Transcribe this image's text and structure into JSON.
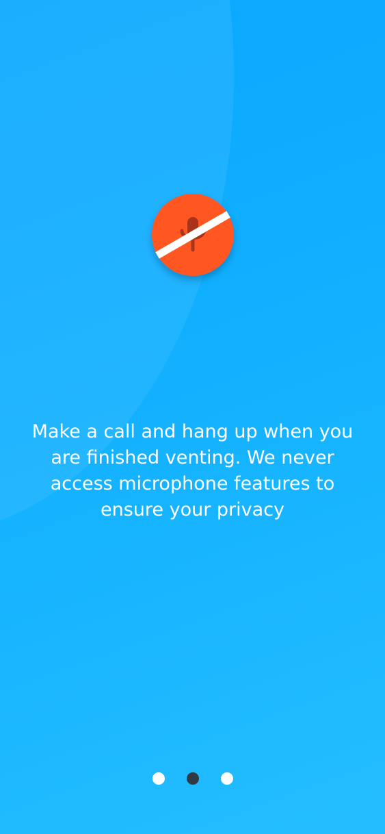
{
  "onboarding": {
    "message": "Make a call and hang up when you are finished venting. We never access microphone features to ensure your privacy",
    "icon": "microphone-off-icon",
    "colors": {
      "background": "#12b0ff",
      "icon_badge": "#ff5722",
      "icon_glyph": "#a8321a",
      "slash": "#ffffff",
      "text": "#ffffff",
      "dot_active": "#2f3a44",
      "dot_inactive": "#ffffff"
    }
  },
  "pager": {
    "total_pages": 3,
    "current_page": 2
  }
}
